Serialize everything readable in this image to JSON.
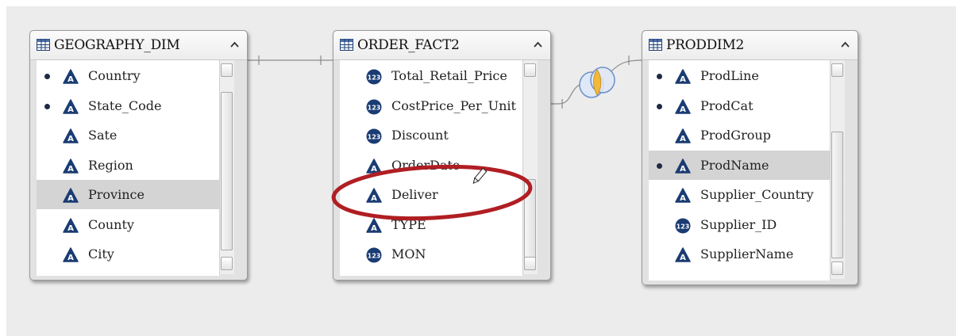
{
  "tables": [
    {
      "title": "GEOGRAPHY_DIM",
      "columns": [
        {
          "label": "Country",
          "type": "char",
          "key": true,
          "selected": false
        },
        {
          "label": "State_Code",
          "type": "char",
          "key": true,
          "selected": false
        },
        {
          "label": "Sate",
          "type": "char",
          "key": false,
          "selected": false
        },
        {
          "label": "Region",
          "type": "char",
          "key": false,
          "selected": false
        },
        {
          "label": "Province",
          "type": "char",
          "key": false,
          "selected": true
        },
        {
          "label": "County",
          "type": "char",
          "key": false,
          "selected": false
        },
        {
          "label": "City",
          "type": "char",
          "key": false,
          "selected": false
        }
      ]
    },
    {
      "title": "ORDER_FACT2",
      "columns": [
        {
          "label": "Total_Retail_Price",
          "type": "num",
          "key": false,
          "selected": false
        },
        {
          "label": "CostPrice_Per_Unit",
          "type": "num",
          "key": false,
          "selected": false
        },
        {
          "label": "Discount",
          "type": "num",
          "key": false,
          "selected": false
        },
        {
          "label": "OrderDate",
          "type": "char",
          "key": false,
          "selected": false
        },
        {
          "label": "Deliver",
          "type": "char",
          "key": false,
          "selected": false
        },
        {
          "label": "TYPE",
          "type": "char",
          "key": false,
          "selected": false
        },
        {
          "label": "MON",
          "type": "num",
          "key": false,
          "selected": false
        }
      ]
    },
    {
      "title": "PRODDIM2",
      "columns": [
        {
          "label": "ProdLine",
          "type": "char",
          "key": true,
          "selected": false
        },
        {
          "label": "ProdCat",
          "type": "char",
          "key": true,
          "selected": false
        },
        {
          "label": "ProdGroup",
          "type": "char",
          "key": false,
          "selected": false
        },
        {
          "label": "ProdName",
          "type": "char",
          "key": true,
          "selected": true
        },
        {
          "label": "Supplier_Country",
          "type": "char",
          "key": false,
          "selected": false
        },
        {
          "label": "Supplier_ID",
          "type": "num",
          "key": false,
          "selected": false
        },
        {
          "label": "SupplierName",
          "type": "char",
          "key": false,
          "selected": false
        }
      ]
    }
  ],
  "icons": {
    "char_column": "char-column-icon",
    "num_column": "numeric-column-icon",
    "table": "table-grid-icon",
    "collapse": "chevron-up-icon",
    "join": "inner-join-icon",
    "cursor": "pencil-cursor-icon"
  },
  "num_icon_text": "123",
  "char_icon_text": "A",
  "colors": {
    "icon_fill": "#1b3c73",
    "annotation": "#b01e23",
    "selected_row": "#d4d4d4",
    "join_yellow": "#f2b83a",
    "join_blue": "#6d8fc8"
  }
}
